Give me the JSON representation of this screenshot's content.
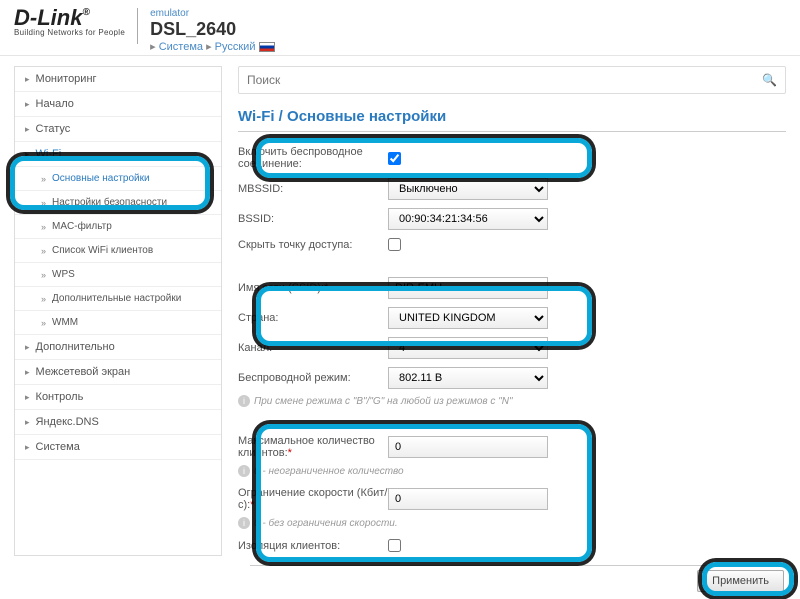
{
  "header": {
    "logo_brand": "D-Link",
    "logo_tagline": "Building Networks for People",
    "emulator": "emulator",
    "model": "DSL_2640",
    "breadcrumb_system": "Система",
    "breadcrumb_lang": "Русский"
  },
  "search": {
    "placeholder": "Поиск"
  },
  "nav": {
    "items": [
      "Мониторинг",
      "Начало",
      "Статус",
      "Wi-Fi",
      "Дополнительно",
      "Межсетевой экран",
      "Контроль",
      "Яндекс.DNS",
      "Система"
    ],
    "wifi_sub": [
      "Основные настройки",
      "Настройки безопасности",
      "MAC-фильтр",
      "Список WiFi клиентов",
      "WPS",
      "Дополнительные настройки",
      "WMM"
    ]
  },
  "page": {
    "title": "Wi-Fi / Основные настройки"
  },
  "form": {
    "enable_label": "Включить беспроводное соединение:",
    "enable_checked": true,
    "mbssid_label": "MBSSID:",
    "mbssid_value": "Выключено",
    "bssid_label": "BSSID:",
    "bssid_value": "00:90:34:21:34:56",
    "hide_ap_label": "Скрыть точку доступа:",
    "hide_ap_checked": false,
    "ssid_label": "Имя сети (SSID):",
    "ssid_value": "DIR-EMU",
    "country_label": "Страна:",
    "country_value": "UNITED KINGDOM",
    "channel_label": "Канал:",
    "channel_value": "4",
    "mode_label": "Беспроводной режим:",
    "mode_value": "802.11 B",
    "mode_hint": "При смене режима с \"B\"/\"G\" на любой из режимов с \"N\"",
    "maxclients_label": "Максимальное количество клиентов:",
    "maxclients_value": "0",
    "maxclients_hint": "0 - неограниченное количество",
    "speedlimit_label": "Ограничение скорости (Кбит/с):",
    "speedlimit_value": "0",
    "speedlimit_hint": "0 - без ограничения скорости.",
    "isolation_label": "Изоляция клиентов:",
    "isolation_checked": false
  },
  "footer": {
    "apply": "Применить"
  }
}
